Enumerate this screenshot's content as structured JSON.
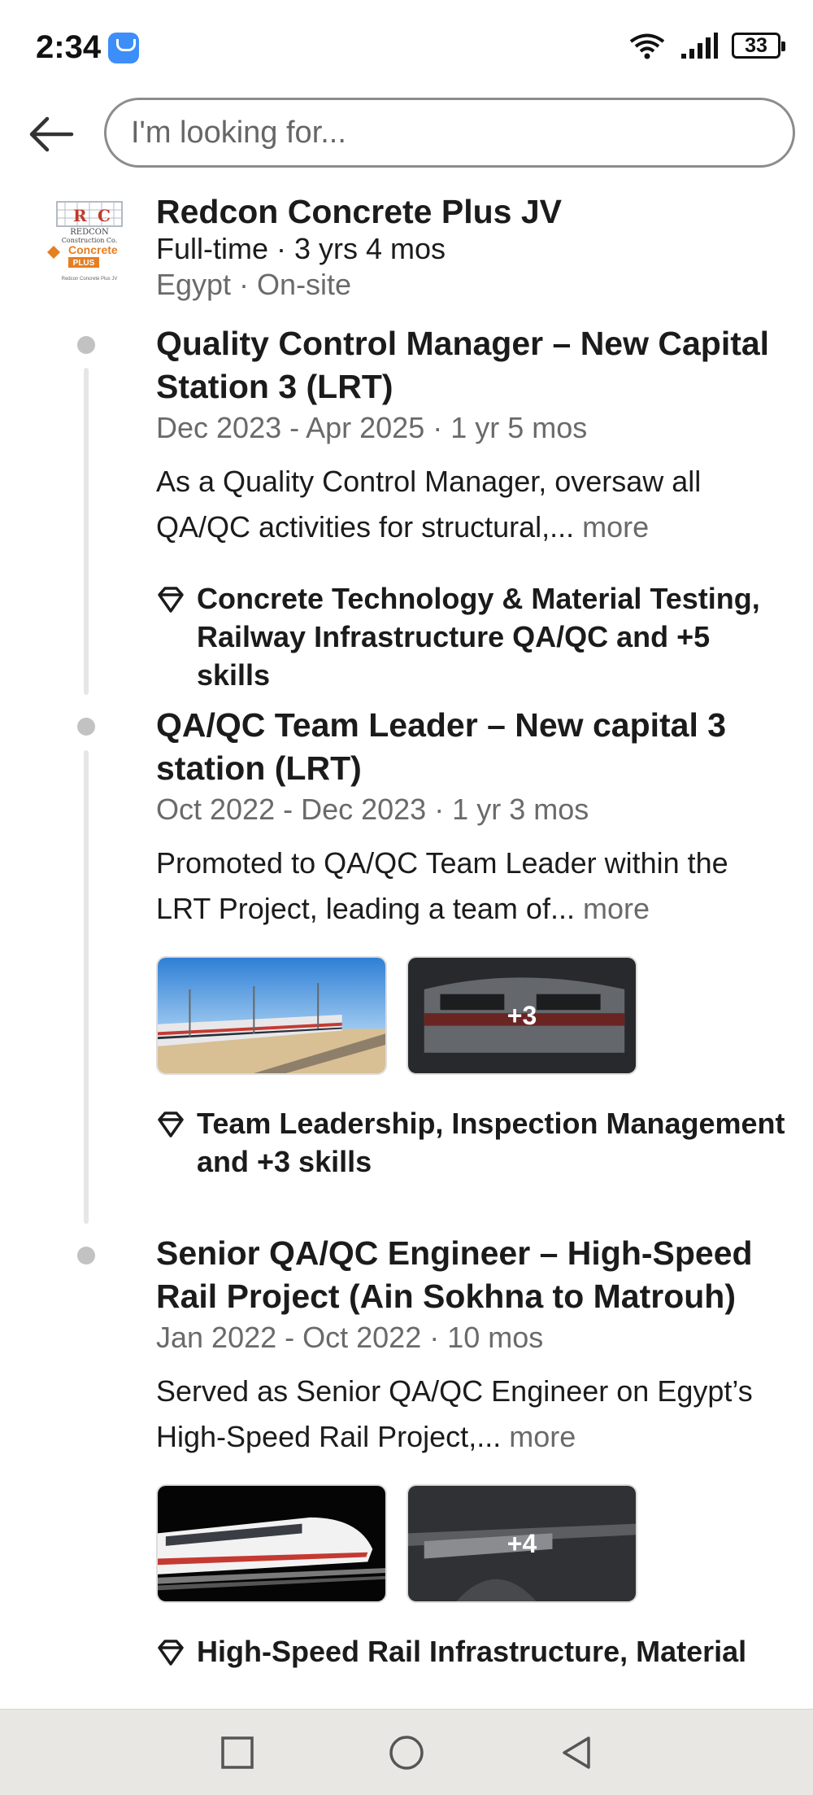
{
  "status_bar": {
    "time": "2:34",
    "battery": "33"
  },
  "search": {
    "placeholder": "I'm looking for..."
  },
  "company": {
    "name": "Redcon Concrete Plus JV",
    "meta": "Full-time · 3 yrs 4 mos",
    "location": "Egypt · On-site",
    "logo": {
      "line1": "REDCON",
      "line2": "Construction Co.",
      "line3": "Concrete",
      "line4": "PLUS",
      "caption": "Redcon Concrete Plus JV"
    }
  },
  "positions": [
    {
      "title": "Quality Control Manager – New Capital Station 3 (LRT)",
      "dates": "Dec 2023 - Apr 2025 · 1 yr 5 mos",
      "description": "As a Quality Control Manager, oversaw all QA/QC activities for structural,...",
      "more": "more",
      "skills": "Concrete Technology & Material Testing, Railway Infrastructure QA/QC and +5 skills"
    },
    {
      "title": "QA/QC Team Leader – New capital 3 station (LRT)",
      "dates": "Oct 2022 - Dec 2023 · 1 yr 3 mos",
      "description": "Promoted to QA/QC Team Leader within the LRT Project, leading a team of...",
      "more": "more",
      "media_extra": "+3",
      "skills": "Team Leadership, Inspection Management and +3 skills"
    },
    {
      "title": "Senior QA/QC Engineer – High-Speed Rail Project (Ain Sokhna to Matrouh)",
      "dates": "Jan 2022 - Oct 2022 · 10 mos",
      "description": "Served as Senior QA/QC Engineer on Egypt’s High-Speed Rail Project,...",
      "more": "more",
      "media_extra": "+4",
      "skills": "High-Speed Rail Infrastructure, Material"
    }
  ]
}
